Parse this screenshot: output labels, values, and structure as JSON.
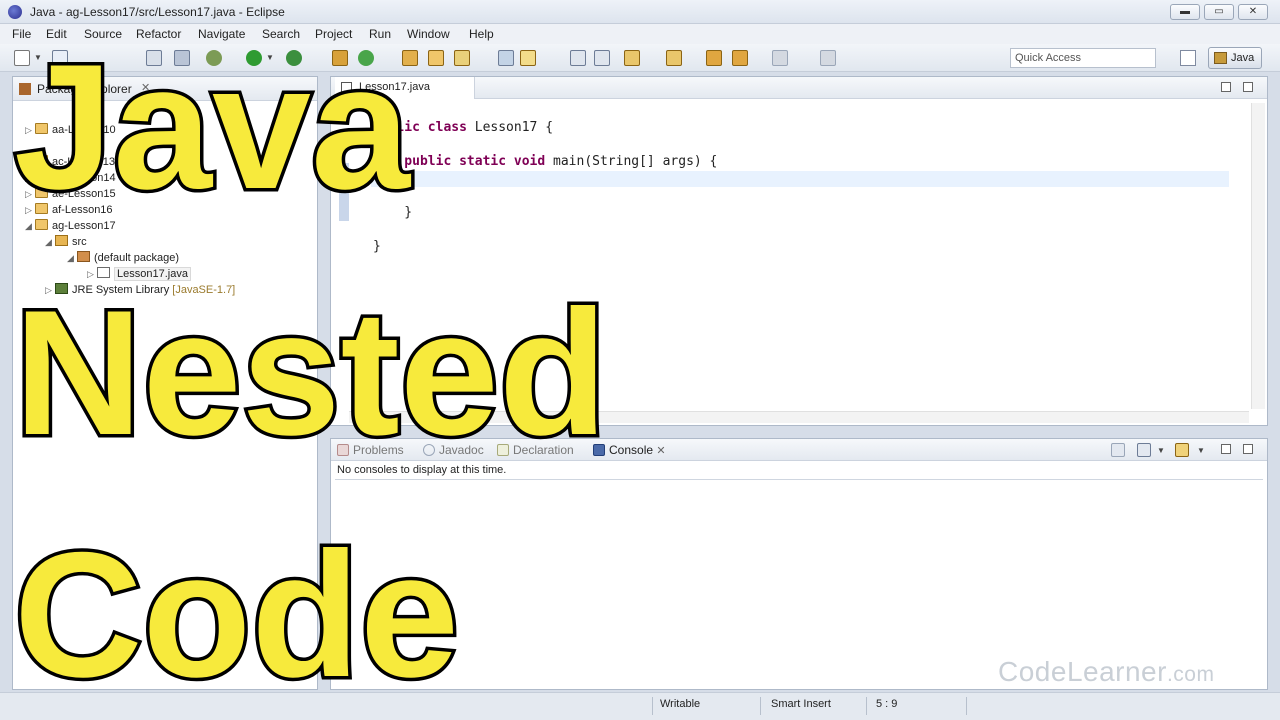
{
  "window": {
    "title": "Java - ag-Lesson17/src/Lesson17.java - Eclipse",
    "controls": [
      "▬",
      "▭",
      "✕"
    ]
  },
  "menu": [
    "File",
    "Edit",
    "Source",
    "Refactor",
    "Navigate",
    "Search",
    "Project",
    "Run",
    "Window",
    "Help"
  ],
  "toolbar": {
    "quick_access_placeholder": "Quick Access",
    "perspective": "Java"
  },
  "package_explorer": {
    "tab_label": "Package Explorer",
    "close": "✕",
    "items": [
      {
        "label": "aa-Lesson10",
        "indent": 0,
        "twisty": "▷",
        "icon": "project"
      },
      {
        "label": "ac-Lesson13",
        "indent": 0,
        "twisty": "▷",
        "icon": "project"
      },
      {
        "label": "ad-Lesson14",
        "indent": 0,
        "twisty": "▷",
        "icon": "project"
      },
      {
        "label": "ae-Lesson15",
        "indent": 0,
        "twisty": "▷",
        "icon": "project"
      },
      {
        "label": "af-Lesson16",
        "indent": 0,
        "twisty": "▷",
        "icon": "project"
      },
      {
        "label": "ag-Lesson17",
        "indent": 0,
        "twisty": "◢",
        "icon": "project"
      },
      {
        "label": "src",
        "indent": 1,
        "twisty": "◢",
        "icon": "src"
      },
      {
        "label": "(default package)",
        "indent": 2,
        "twisty": "◢",
        "icon": "package"
      },
      {
        "label": "Lesson17.java",
        "indent": 3,
        "twisty": "▷",
        "icon": "java"
      }
    ],
    "jre": {
      "label": "JRE System Library",
      "version": "[JavaSE-1.7]"
    }
  },
  "editor": {
    "tab_label": "Lesson17.java",
    "code_lines": [
      {
        "kw": "public class ",
        "text": "Lesson17 {"
      },
      {
        "kw": "    public static void ",
        "text": "main(String[] args) {"
      },
      {
        "kw": "",
        "text": ""
      },
      {
        "kw": "",
        "text": "    }"
      },
      {
        "kw": "",
        "text": "}"
      }
    ]
  },
  "console_panel": {
    "tabs": [
      {
        "label": "Problems",
        "active": false
      },
      {
        "label": "Javadoc",
        "active": false
      },
      {
        "label": "Declaration",
        "active": false
      },
      {
        "label": "Console",
        "active": true
      }
    ],
    "close": "✕",
    "message": "No consoles to display at this time."
  },
  "status_bar": {
    "writable": "Writable",
    "insert_mode": "Smart Insert",
    "position": "5 : 9"
  },
  "overlay_title": [
    "Java",
    "Nested",
    "Code"
  ],
  "watermark": {
    "main": "CodeLearner",
    "suffix": ".com"
  },
  "colors": {
    "overlay_fill": "#f7ea3c",
    "overlay_stroke": "#000000",
    "keyword": "#7f0055"
  }
}
